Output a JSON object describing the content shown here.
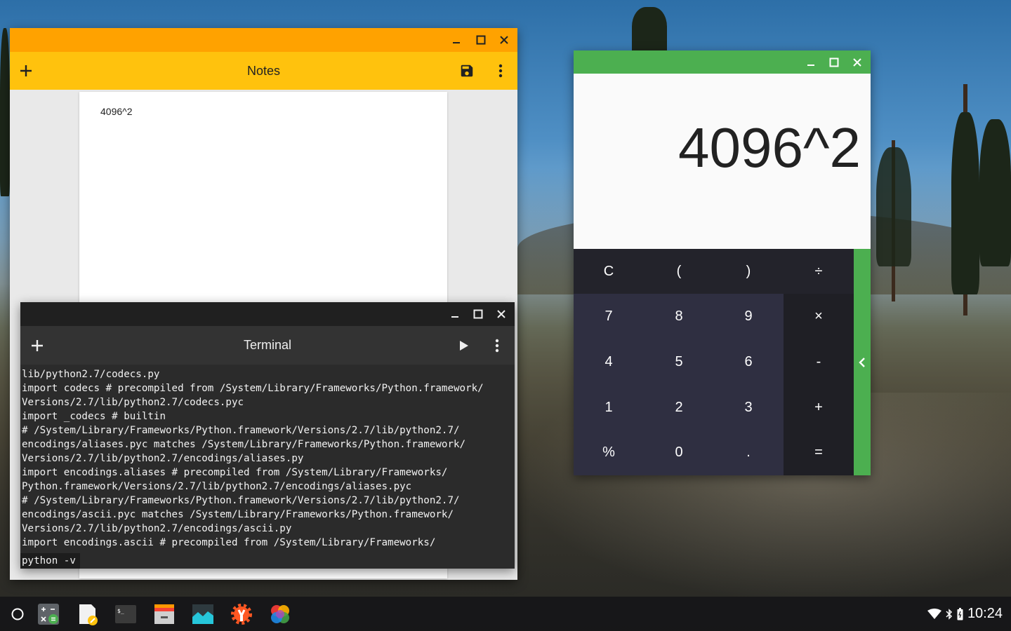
{
  "notes": {
    "title": "Notes",
    "content": "4096^2",
    "icons": {
      "add": "plus-icon",
      "save": "save-icon",
      "menu": "more-vert-icon"
    }
  },
  "terminal": {
    "title": "Terminal",
    "lines": [
      "lib/python2.7/codecs.py",
      "import codecs # precompiled from /System/Library/Frameworks/Python.framework/",
      "Versions/2.7/lib/python2.7/codecs.pyc",
      "import _codecs # builtin",
      "# /System/Library/Frameworks/Python.framework/Versions/2.7/lib/python2.7/",
      "encodings/aliases.pyc matches /System/Library/Frameworks/Python.framework/",
      "Versions/2.7/lib/python2.7/encodings/aliases.py",
      "import encodings.aliases # precompiled from /System/Library/Frameworks/",
      "Python.framework/Versions/2.7/lib/python2.7/encodings/aliases.pyc",
      "# /System/Library/Frameworks/Python.framework/Versions/2.7/lib/python2.7/",
      "encodings/ascii.pyc matches /System/Library/Frameworks/Python.framework/",
      "Versions/2.7/lib/python2.7/encodings/ascii.py",
      "import encodings.ascii # precompiled from /System/Library/Frameworks/"
    ],
    "command": "python -v",
    "icons": {
      "add": "plus-icon",
      "run": "play-icon",
      "menu": "more-vert-icon"
    }
  },
  "calculator": {
    "display": "4096^2",
    "keys": {
      "row1": [
        "C",
        "(",
        ")",
        "÷"
      ],
      "row2": [
        "7",
        "8",
        "9",
        "×"
      ],
      "row3": [
        "4",
        "5",
        "6",
        "-"
      ],
      "row4": [
        "1",
        "2",
        "3",
        "+"
      ],
      "row5": [
        "%",
        "0",
        ".",
        "="
      ]
    }
  },
  "shelf": {
    "apps": [
      "calculator-app-icon",
      "notes-app-icon",
      "terminal-app-icon",
      "files-app-icon",
      "wallpaper-app-icon",
      "settings-app-icon",
      "photos-app-icon"
    ],
    "clock": "10:24"
  },
  "colors": {
    "notes_titlebar": "#ffa200",
    "notes_appbar": "#ffc20d",
    "calc_accent": "#4caf50",
    "terminal_bg": "#2b2b2b"
  }
}
